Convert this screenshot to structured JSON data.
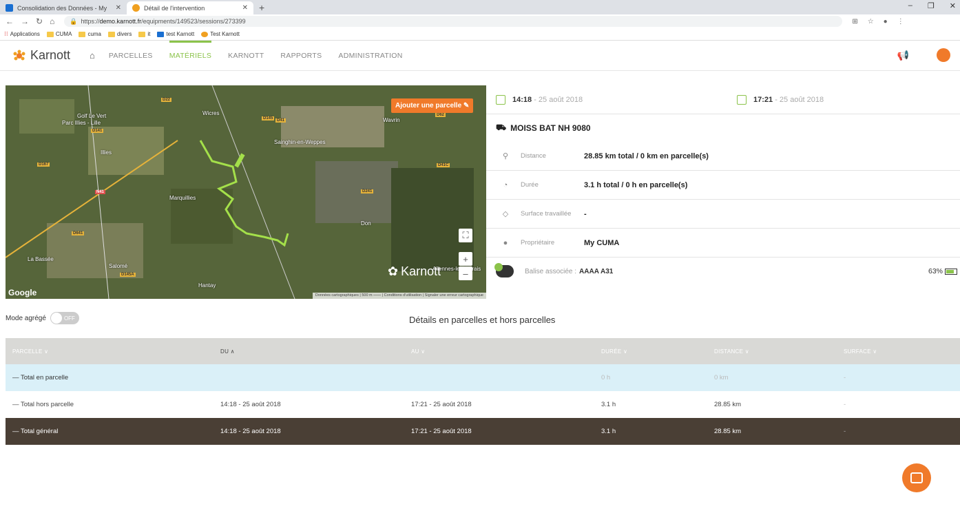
{
  "browser": {
    "tabs": [
      {
        "title": "Consolidation des Données - My",
        "active": false
      },
      {
        "title": "Détail de l'intervention",
        "active": true
      }
    ],
    "url_scheme": "https://",
    "url_host": "demo.karnott.fr",
    "url_path": "/equipments/149523/sessions/273399",
    "bookmarks": [
      "Applications",
      "CUMA",
      "cuma",
      "divers",
      "it",
      "test Karnott",
      "Test Karnott"
    ]
  },
  "app": {
    "brand": "Karnott",
    "nav": [
      "PARCELLES",
      "MATÉRIELS",
      "KARNOTT",
      "RAPPORTS",
      "ADMINISTRATION"
    ],
    "active_nav": "MATÉRIELS",
    "accent": "#8bc34a",
    "orange": "#f07a2a"
  },
  "map": {
    "add_parcel": "Ajouter une parcelle",
    "google": "Google",
    "watermark": "Karnott",
    "footer": "Données cartographiques | 500 m ⎯⎯⎯⎯ | Conditions d'utilisation | Signaler une erreur cartographique",
    "labels": [
      "Golf Le Vert",
      "Parc Illies - Lille",
      "Illies",
      "Wicres",
      "Sainghin-en-Weppes",
      "Marquillies",
      "Wavrin",
      "Don",
      "La Bassée",
      "Salomé",
      "Hantay",
      "Allennes-les-Marais"
    ],
    "roads": [
      "D22",
      "N41",
      "D145",
      "D141",
      "D167",
      "D41",
      "D41C",
      "D62",
      "D241",
      "D641",
      "D145A"
    ]
  },
  "session": {
    "start_time": "14:18",
    "start_date": " - 25 août 2018",
    "end_time": "17:21",
    "end_date": " - 25 août 2018",
    "equipment": "MOISS BAT NH 9080",
    "rows": [
      {
        "label": "Distance",
        "value": "28.85 km total / 0 km en parcelle(s)"
      },
      {
        "label": "Durée",
        "value": "3.1 h total / 0 h en parcelle(s)"
      },
      {
        "label": "Surface travaillée",
        "value": "-"
      },
      {
        "label": "Propriétaire",
        "value": "My CUMA"
      }
    ],
    "balise_label": "Balise associée :",
    "balise_value": "AAAA A31",
    "battery": "63%",
    "battery_level": 0.63
  },
  "details": {
    "mode_label": "Mode agrégé",
    "toggle": "OFF",
    "title": "Détails en parcelles et hors parcelles",
    "columns": [
      "PARCELLE ∨",
      "DU ∧",
      "AU ∨",
      "DURÉE ∨",
      "DISTANCE ∨",
      "SURFACE ∨"
    ],
    "rows": [
      [
        "— Total en parcelle",
        "",
        "",
        "0 h",
        "0 km",
        "-"
      ],
      [
        "— Total hors parcelle",
        "14:18 - 25 août 2018",
        "17:21 - 25 août 2018",
        "3.1 h",
        "28.85 km",
        "-"
      ],
      [
        "— Total général",
        "14:18 - 25 août 2018",
        "17:21 - 25 août 2018",
        "3.1 h",
        "28.85 km",
        "-"
      ]
    ]
  }
}
